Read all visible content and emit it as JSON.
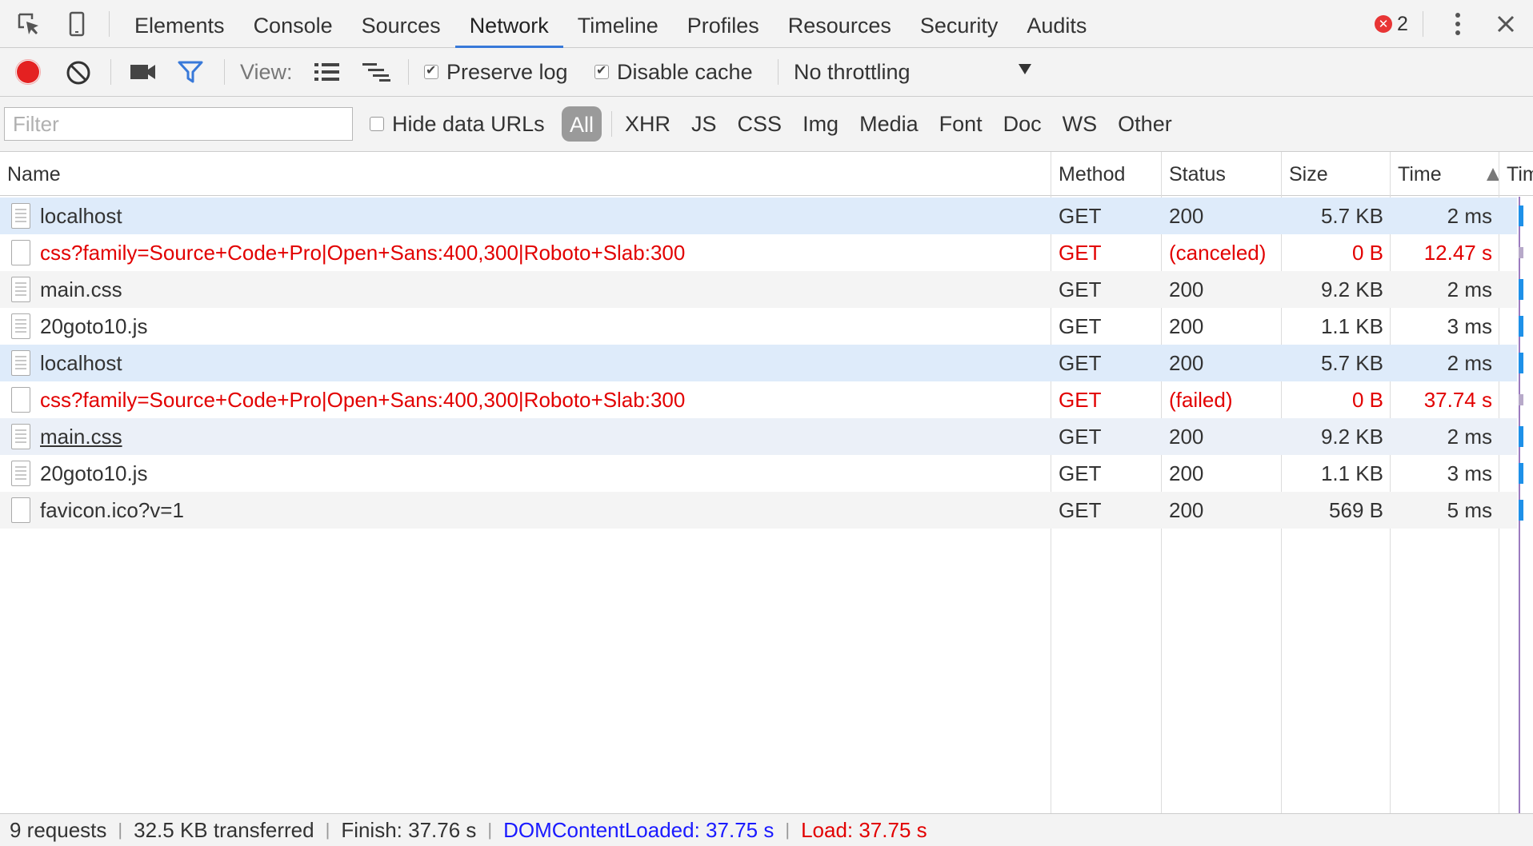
{
  "devtools": {
    "tabs": [
      {
        "label": "Elements"
      },
      {
        "label": "Console"
      },
      {
        "label": "Sources"
      },
      {
        "label": "Network"
      },
      {
        "label": "Timeline"
      },
      {
        "label": "Profiles"
      },
      {
        "label": "Resources"
      },
      {
        "label": "Security"
      },
      {
        "label": "Audits"
      }
    ],
    "active_tab": "Network",
    "error_count": "2",
    "icons": {
      "inspect": "inspect-element-icon",
      "device": "device-mode-icon",
      "more": "more-vertical-icon",
      "close": "close-icon",
      "error": "error-icon"
    }
  },
  "toolbar": {
    "view_label": "View:",
    "preserve_log_label": "Preserve log",
    "preserve_log_checked": true,
    "disable_cache_label": "Disable cache",
    "disable_cache_checked": true,
    "throttling_value": "No throttling",
    "colors": {
      "record": "#e42121",
      "filter_active": "#3879d9"
    }
  },
  "filterbar": {
    "filter_placeholder": "Filter",
    "filter_value": "",
    "hide_data_urls_label": "Hide data URLs",
    "hide_data_urls_checked": false,
    "types": [
      "All",
      "XHR",
      "JS",
      "CSS",
      "Img",
      "Media",
      "Font",
      "Doc",
      "WS",
      "Other"
    ],
    "selected_type": "All"
  },
  "table": {
    "headers": {
      "name": "Name",
      "method": "Method",
      "status": "Status",
      "size": "Size",
      "time": "Time",
      "timeline": "Timeline"
    },
    "sort": {
      "column": "Time",
      "direction": "ascending"
    },
    "rows": [
      {
        "name": "localhost",
        "method": "GET",
        "status": "200",
        "size": "5.7 KB",
        "time": "2 ms",
        "error": false,
        "icon": "document-icon"
      },
      {
        "name": "css?family=Source+Code+Pro|Open+Sans:400,300|Roboto+Slab:300",
        "method": "GET",
        "status": "(canceled)",
        "size": "0 B",
        "time": "12.47 s",
        "error": true,
        "icon": "blank-file-icon"
      },
      {
        "name": "main.css",
        "method": "GET",
        "status": "200",
        "size": "9.2 KB",
        "time": "2 ms",
        "error": false,
        "icon": "document-icon"
      },
      {
        "name": "20goto10.js",
        "method": "GET",
        "status": "200",
        "size": "1.1 KB",
        "time": "3 ms",
        "error": false,
        "icon": "document-icon"
      },
      {
        "name": "localhost",
        "method": "GET",
        "status": "200",
        "size": "5.7 KB",
        "time": "2 ms",
        "error": false,
        "icon": "document-icon"
      },
      {
        "name": "css?family=Source+Code+Pro|Open+Sans:400,300|Roboto+Slab:300",
        "method": "GET",
        "status": "(failed)",
        "size": "0 B",
        "time": "37.74 s",
        "error": true,
        "icon": "blank-file-icon"
      },
      {
        "name": "main.css",
        "method": "GET",
        "status": "200",
        "size": "9.2 KB",
        "time": "2 ms",
        "error": false,
        "icon": "document-icon"
      },
      {
        "name": "20goto10.js",
        "method": "GET",
        "status": "200",
        "size": "1.1 KB",
        "time": "3 ms",
        "error": false,
        "icon": "document-icon"
      },
      {
        "name": "favicon.ico?v=1",
        "method": "GET",
        "status": "200",
        "size": "569 B",
        "time": "5 ms",
        "error": false,
        "icon": "blank-file-icon"
      }
    ],
    "colors": {
      "error_text": "#e20000",
      "selected_row": "#deebfa",
      "waterfall": "#1e90e8"
    }
  },
  "statusbar": {
    "requests": "9 requests",
    "transferred": "32.5 KB transferred",
    "finish": "Finish: 37.76 s",
    "dom_content_loaded": "DOMContentLoaded: 37.75 s",
    "load": "Load: 37.75 s",
    "colors": {
      "dom_content_loaded": "#1a1aff",
      "load": "#e20000"
    }
  }
}
